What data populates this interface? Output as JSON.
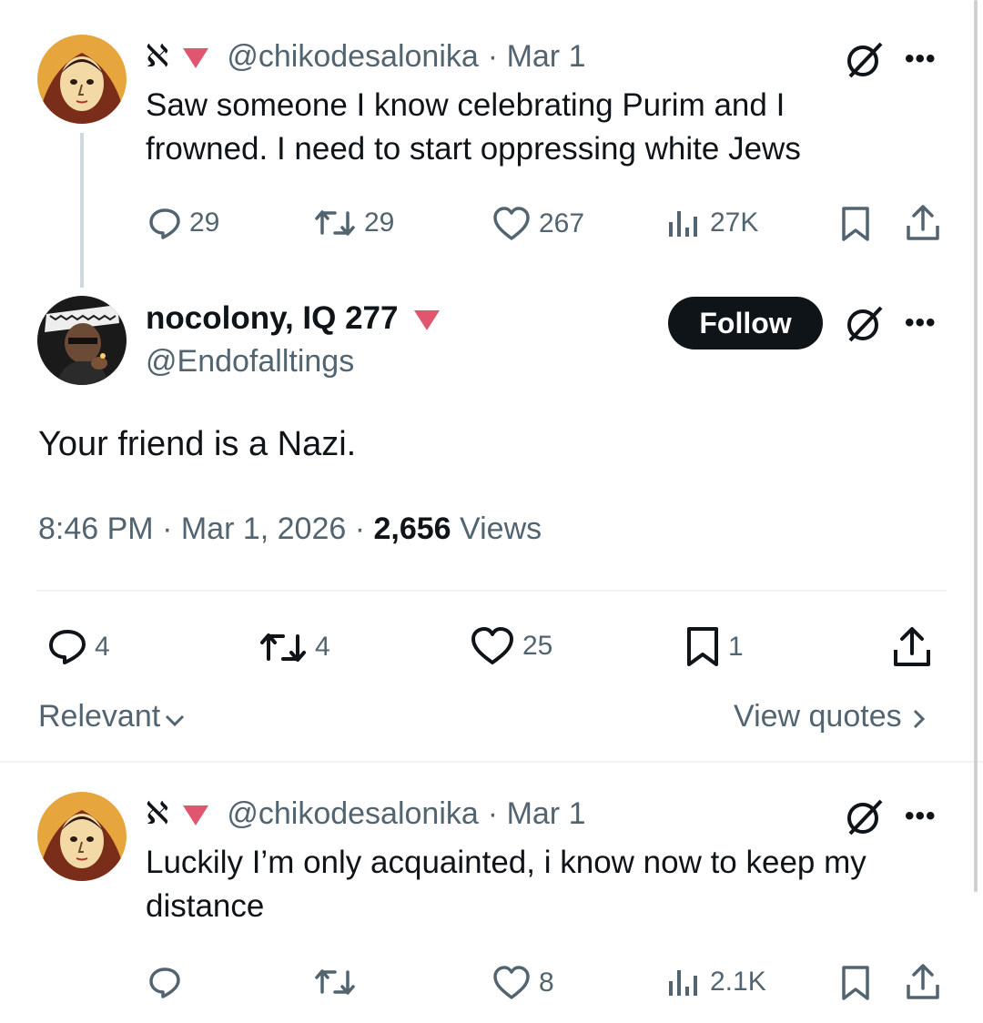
{
  "post1": {
    "handle": "@chikodesalonika",
    "date": "· Mar 1",
    "aleph": "ℵ",
    "text": "Saw someone I know celebrating Purim and I frowned. I need to start oppressing white Jews",
    "replies": "29",
    "reposts": "29",
    "likes": "267",
    "views": "27K"
  },
  "main": {
    "name": "nocolony, IQ 277",
    "handle": "@Endofalltings",
    "follow_label": "Follow",
    "text": "Your friend is a Nazi.",
    "timestamp": "8:46 PM · Mar 1, 2026 · ",
    "views_count": "2,656",
    "views_label": " Views",
    "replies": "4",
    "reposts": "4",
    "likes": "25",
    "bookmarks": "1",
    "sort_label": "Relevant",
    "quotes_label": "View quotes"
  },
  "post2": {
    "handle": "@chikodesalonika",
    "date": "· Mar 1",
    "aleph": "ℵ",
    "text": "Luckily I’m only acquainted, i know now to keep my distance",
    "likes": "8",
    "views": "2.1K"
  },
  "more_label": "•••",
  "colors": {
    "accent_red": "#e0566f",
    "text": "#0f1419",
    "muted": "#536471",
    "divider": "#eff3f4"
  }
}
